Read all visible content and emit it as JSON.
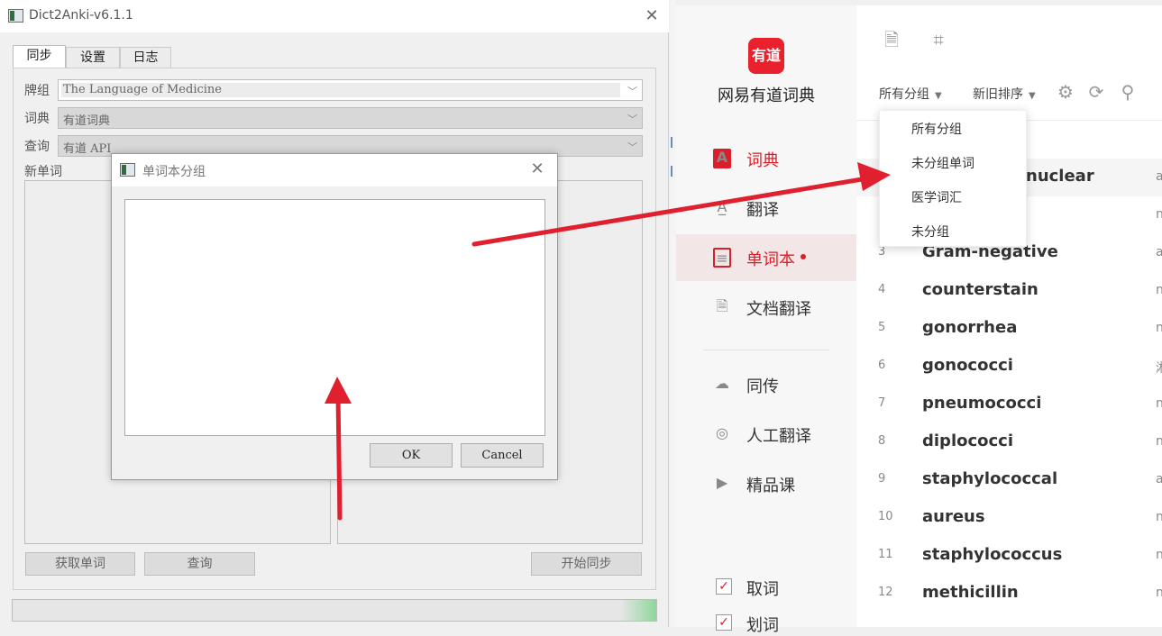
{
  "anki": {
    "title": "Dict2Anki-v6.1.1",
    "tabs": [
      "同步",
      "设置",
      "日志"
    ],
    "deck_label": "牌组",
    "deck_value": "The Language of Medicine",
    "dict_label": "词典",
    "dict_value": "有道词典",
    "query_label": "查询",
    "query_value": "有道 API",
    "new_words_label": "新单词",
    "buttons": {
      "fetch": "获取单词",
      "query": "查询",
      "sync": "开始同步"
    }
  },
  "dialog": {
    "title": "单词本分组",
    "ok": "OK",
    "cancel": "Cancel"
  },
  "youdao": {
    "brand": "网易有道词典",
    "logo_text": "有道",
    "nav": [
      {
        "label": "词典",
        "icon": "dictionary-icon"
      },
      {
        "label": "翻译",
        "icon": "translate-icon"
      },
      {
        "label": "单词本",
        "icon": "wordbook-icon"
      },
      {
        "label": "文档翻译",
        "icon": "document-icon"
      },
      {
        "label": "同传",
        "icon": "simul-icon"
      },
      {
        "label": "人工翻译",
        "icon": "human-translate-icon"
      },
      {
        "label": "精品课",
        "icon": "course-icon"
      }
    ],
    "checkboxes": [
      {
        "label": "取词",
        "checked": true
      },
      {
        "label": "划词",
        "checked": true
      }
    ],
    "filter_group": "所有分组",
    "filter_sort": "新旧排序",
    "dropdown_options": [
      "所有分组",
      "未分组单词",
      "医学词汇",
      "未分组"
    ],
    "words": [
      {
        "num": "",
        "word": "nuclear",
        "tail": "a"
      },
      {
        "num": "",
        "word": "",
        "tail": "n"
      },
      {
        "num": "3",
        "word": "Gram-negative",
        "tail": "a"
      },
      {
        "num": "4",
        "word": "counterstain",
        "tail": "n"
      },
      {
        "num": "5",
        "word": "gonorrhea",
        "tail": "n"
      },
      {
        "num": "6",
        "word": "gonococci",
        "tail": "淋"
      },
      {
        "num": "7",
        "word": "pneumococci",
        "tail": "n"
      },
      {
        "num": "8",
        "word": "diplococci",
        "tail": "n"
      },
      {
        "num": "9",
        "word": "staphylococcal",
        "tail": "a"
      },
      {
        "num": "10",
        "word": "aureus",
        "tail": "n"
      },
      {
        "num": "11",
        "word": "staphylococcus",
        "tail": "n"
      },
      {
        "num": "12",
        "word": "methicillin",
        "tail": "n"
      }
    ],
    "colors": {
      "accent": "#d91f2a",
      "annotation_arrow": "#e0202e"
    }
  }
}
